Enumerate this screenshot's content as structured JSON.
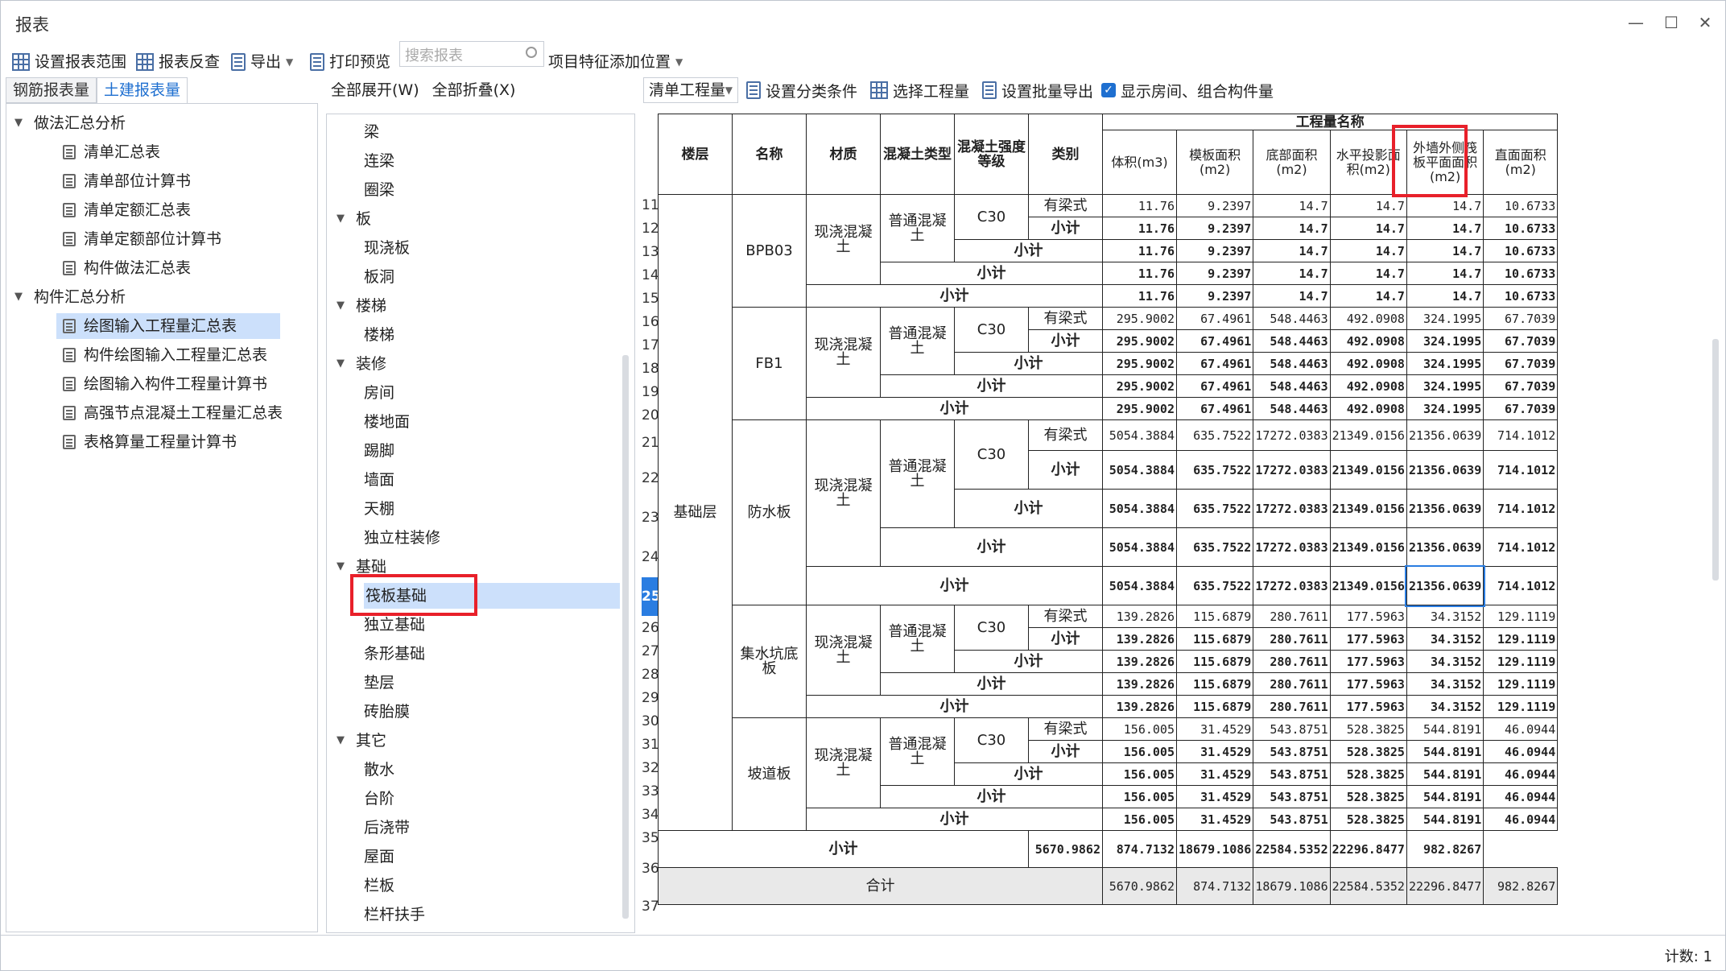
{
  "window": {
    "title": "报表"
  },
  "toolbar": {
    "set_range": "设置报表范围",
    "report_check": "报表反查",
    "export": "导出",
    "print_preview": "打印预览",
    "search_placeholder": "搜索报表",
    "project_feature": "项目特征添加位置"
  },
  "left": {
    "tabs": [
      "钢筋报表量",
      "土建报表量"
    ],
    "groups": [
      {
        "label": "做法汇总分析",
        "items": [
          "清单汇总表",
          "清单部位计算书",
          "清单定额汇总表",
          "清单定额部位计算书",
          "构件做法汇总表"
        ]
      },
      {
        "label": "构件汇总分析",
        "items": [
          "绘图输入工程量汇总表",
          "构件绘图输入工程量汇总表",
          "绘图输入构件工程量计算书",
          "高强节点混凝土工程量汇总表",
          "表格算量工程量计算书"
        ]
      }
    ]
  },
  "middle": {
    "expand_all": "全部展开(W)",
    "collapse_all": "全部折叠(X)",
    "tree": [
      {
        "type": "leaf",
        "label": "梁"
      },
      {
        "type": "leaf",
        "label": "连梁"
      },
      {
        "type": "leaf",
        "label": "圈梁"
      },
      {
        "type": "group",
        "label": "板"
      },
      {
        "type": "leaf",
        "label": "现浇板"
      },
      {
        "type": "leaf",
        "label": "板洞"
      },
      {
        "type": "group",
        "label": "楼梯"
      },
      {
        "type": "leaf",
        "label": "楼梯"
      },
      {
        "type": "group",
        "label": "装修"
      },
      {
        "type": "leaf",
        "label": "房间"
      },
      {
        "type": "leaf",
        "label": "楼地面"
      },
      {
        "type": "leaf",
        "label": "踢脚"
      },
      {
        "type": "leaf",
        "label": "墙面"
      },
      {
        "type": "leaf",
        "label": "天棚"
      },
      {
        "type": "leaf",
        "label": "独立柱装修"
      },
      {
        "type": "group",
        "label": "基础"
      },
      {
        "type": "leaf",
        "label": "筏板基础",
        "selected": true
      },
      {
        "type": "leaf",
        "label": "独立基础"
      },
      {
        "type": "leaf",
        "label": "条形基础"
      },
      {
        "type": "leaf",
        "label": "垫层"
      },
      {
        "type": "leaf",
        "label": "砖胎膜"
      },
      {
        "type": "group",
        "label": "其它"
      },
      {
        "type": "leaf",
        "label": "散水"
      },
      {
        "type": "leaf",
        "label": "台阶"
      },
      {
        "type": "leaf",
        "label": "后浇带"
      },
      {
        "type": "leaf",
        "label": "屋面"
      },
      {
        "type": "leaf",
        "label": "栏板"
      },
      {
        "type": "leaf",
        "label": "栏杆扶手"
      }
    ]
  },
  "right_toolbar": {
    "combo": "清单工程量",
    "set_category": "设置分类条件",
    "select_quantity": "选择工程量",
    "batch_export": "设置批量导出",
    "show_rooms": "显示房间、组合构件量"
  },
  "table": {
    "group_header": "工程量名称",
    "headers": [
      "楼层",
      "名称",
      "材质",
      "混凝土类型",
      "混凝土强度等级",
      "类别",
      "体积(m3)",
      "模板面积(m2)",
      "底部面积(m2)",
      "水平投影面积(m2)",
      "外墙外侧筏板平面面积(m2)",
      "直面面积(m2)"
    ],
    "floor": "基础层",
    "material": "现浇混凝土",
    "concrete_type": "普通混凝土",
    "grade": "C30",
    "cat_beam": "有梁式",
    "subtotal": "小计",
    "total_label": "合计",
    "row_numbers": [
      "11",
      "12",
      "13",
      "14",
      "15",
      "16",
      "17",
      "18",
      "19",
      "20",
      "21",
      "22",
      "23",
      "24",
      "25",
      "26",
      "27",
      "28",
      "29",
      "30",
      "31",
      "32",
      "33",
      "34",
      "35",
      "36",
      "37"
    ],
    "groups": [
      {
        "name": "BPB03",
        "first": [
          "11.76",
          "9.2397",
          "14.7",
          "14.7",
          "14.7",
          "10.6733"
        ],
        "sub": [
          "11.76",
          "9.2397",
          "14.7",
          "14.7",
          "14.7",
          "10.6733"
        ]
      },
      {
        "name": "FB1",
        "first": [
          "295.9002",
          "67.4961",
          "548.4463",
          "492.0908",
          "324.1995",
          "67.7039"
        ],
        "sub": [
          "295.9002",
          "67.4961",
          "548.4463",
          "492.0908",
          "324.1995",
          "67.7039"
        ]
      },
      {
        "name": "防水板",
        "first": [
          "5054.3884",
          "635.7522",
          "17272.0383",
          "21349.0156",
          "21356.0639",
          "714.1012"
        ],
        "sub": [
          "5054.3884",
          "635.7522",
          "17272.0383",
          "21349.0156",
          "21356.0639",
          "714.1012"
        ]
      },
      {
        "name": "集水坑底板",
        "first": [
          "139.2826",
          "115.6879",
          "280.7611",
          "177.5963",
          "34.3152",
          "129.1119"
        ],
        "sub": [
          "139.2826",
          "115.6879",
          "280.7611",
          "177.5963",
          "34.3152",
          "129.1119"
        ]
      },
      {
        "name": "坡道板",
        "first": [
          "156.005",
          "31.4529",
          "543.8751",
          "528.3825",
          "544.8191",
          "46.0944"
        ],
        "sub": [
          "156.005",
          "31.4529",
          "543.8751",
          "528.3825",
          "544.8191",
          "46.0944"
        ]
      }
    ],
    "floor_subtotal": [
      "5670.9862",
      "874.7132",
      "18679.1086",
      "22584.5352",
      "22296.8477",
      "982.8267"
    ],
    "total": [
      "5670.9862",
      "874.7132",
      "18679.1086",
      "22584.5352",
      "22296.8477",
      "982.8267"
    ]
  },
  "status": {
    "count": "计数: 1"
  }
}
